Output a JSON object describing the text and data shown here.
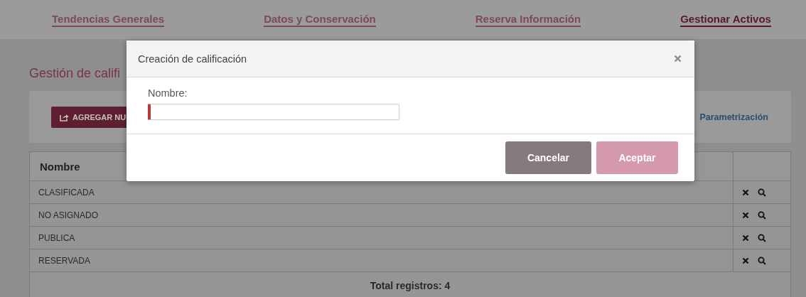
{
  "nav": [
    {
      "label": "Tendencias Generales",
      "selected": false
    },
    {
      "label": "Datos y Conservación",
      "selected": false
    },
    {
      "label": "Reserva Información",
      "selected": false
    },
    {
      "label": "Gestionar Activos",
      "selected": true
    }
  ],
  "page_title": "Gestión de califi",
  "toolbar": {
    "add_button": "AGREGAR NU",
    "link": "Parametrización"
  },
  "table": {
    "columns": [
      "Nombre"
    ],
    "rows": [
      {
        "name": "CLASIFICADA"
      },
      {
        "name": "NO ASIGNADO"
      },
      {
        "name": "PUBLICA"
      },
      {
        "name": "RESERVADA"
      }
    ],
    "footer": "Total registros: 4"
  },
  "modal": {
    "title": "Creación de calificación",
    "field": {
      "label": "Nombre:",
      "invalid": true
    },
    "buttons": [
      {
        "label": "Cancelar",
        "kind": "secondary",
        "disabled": false
      },
      {
        "label": "Aceptar",
        "kind": "primary",
        "disabled": true
      }
    ]
  }
}
